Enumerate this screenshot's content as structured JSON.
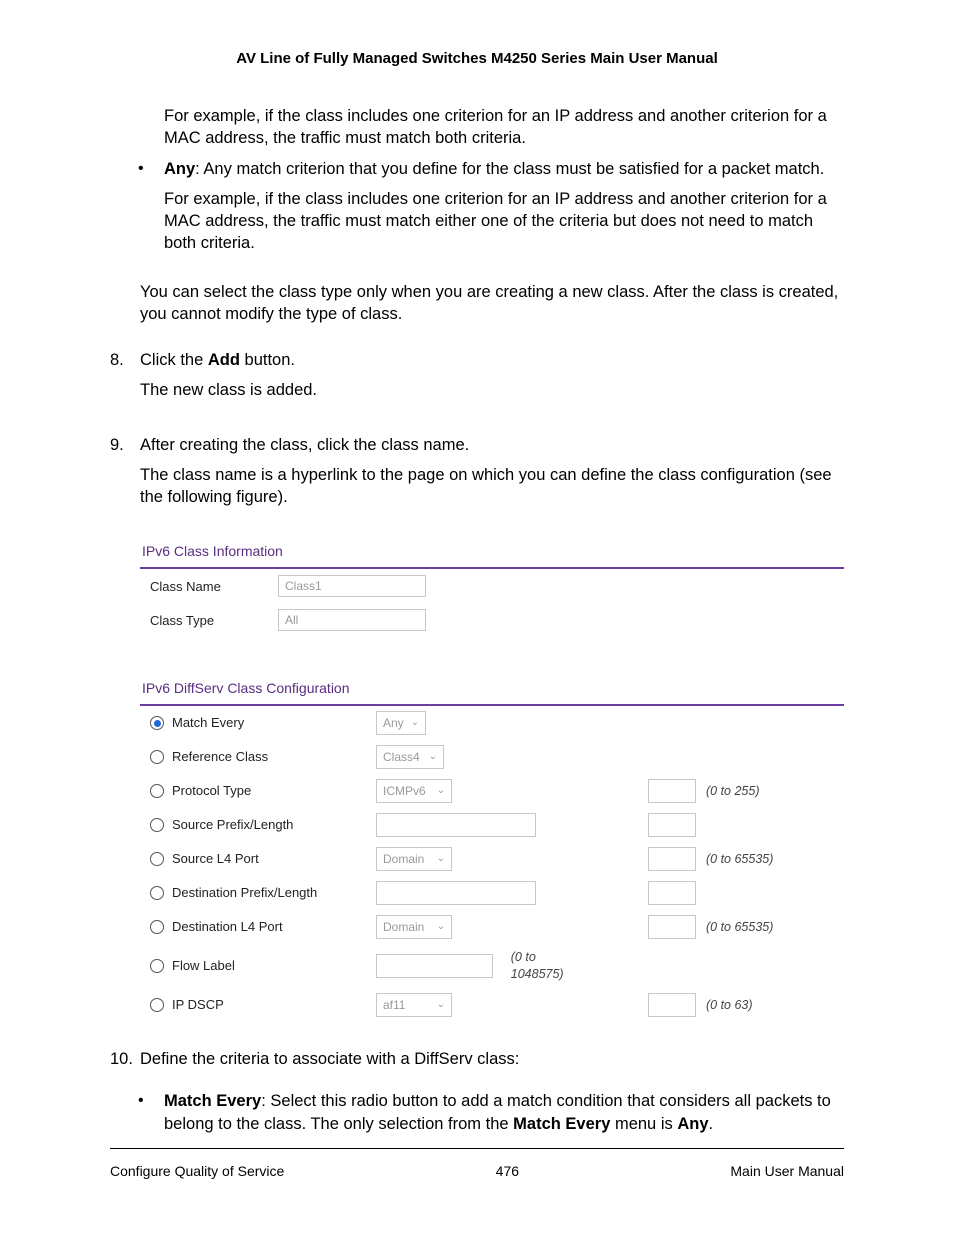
{
  "header": {
    "title": "AV Line of Fully Managed Switches M4250 Series Main User Manual"
  },
  "p1": "For example, if the class includes one criterion for an IP address and another criterion for a MAC address, the traffic must match both criteria.",
  "any_label": "Any",
  "any_text": ": Any match criterion that you define for the class must be satisfied for a packet match.",
  "any_example": "For example, if the class includes one criterion for an IP address and another criterion for a MAC address, the traffic must match either one of the criteria but does not need to match both criteria.",
  "p_select": "You can select the class type only when you are creating a new class. After the class is created, you cannot modify the type of class.",
  "step8_num": "8.",
  "step8_a": "Click the ",
  "step8_b": "Add",
  "step8_c": " button.",
  "step8_sub": "The new class is added.",
  "step9_num": "9.",
  "step9": "After creating the class, click the class name.",
  "step9_sub": "The class name is a hyperlink to the page on which you can define the class configuration (see the following figure).",
  "panel": {
    "title1": "IPv6 Class Information",
    "class_name_label": "Class Name",
    "class_name_value": "Class1",
    "class_type_label": "Class Type",
    "class_type_value": "All",
    "title2": "IPv6 DiffServ Class Configuration",
    "rows": {
      "match_every": "Match Every",
      "match_every_val": "Any",
      "reference_class": "Reference Class",
      "reference_class_val": "Class4",
      "protocol_type": "Protocol Type",
      "protocol_type_val": "ICMPv6",
      "protocol_type_hint": "(0 to 255)",
      "source_prefix": "Source Prefix/Length",
      "source_l4": "Source L4 Port",
      "source_l4_val": "Domain",
      "source_l4_hint": "(0 to 65535)",
      "dest_prefix": "Destination Prefix/Length",
      "dest_l4": "Destination L4 Port",
      "dest_l4_val": "Domain",
      "dest_l4_hint": "(0 to 65535)",
      "flow_label": "Flow Label",
      "flow_label_hint": "(0 to 1048575)",
      "ip_dscp": "IP DSCP",
      "ip_dscp_val": "af11",
      "ip_dscp_hint": "(0 to 63)"
    }
  },
  "step10_num": "10.",
  "step10": "Define the criteria to associate with a DiffServ class:",
  "me_label": "Match Every",
  "me_text1": ": Select this radio button to add a match condition that considers all packets to belong to the class. The only selection from the ",
  "me_label2": "Match Every",
  "me_text2": " menu is ",
  "me_any": "Any",
  "me_text3": ".",
  "footer": {
    "left": "Configure Quality of Service",
    "center": "476",
    "right": "Main User Manual"
  }
}
